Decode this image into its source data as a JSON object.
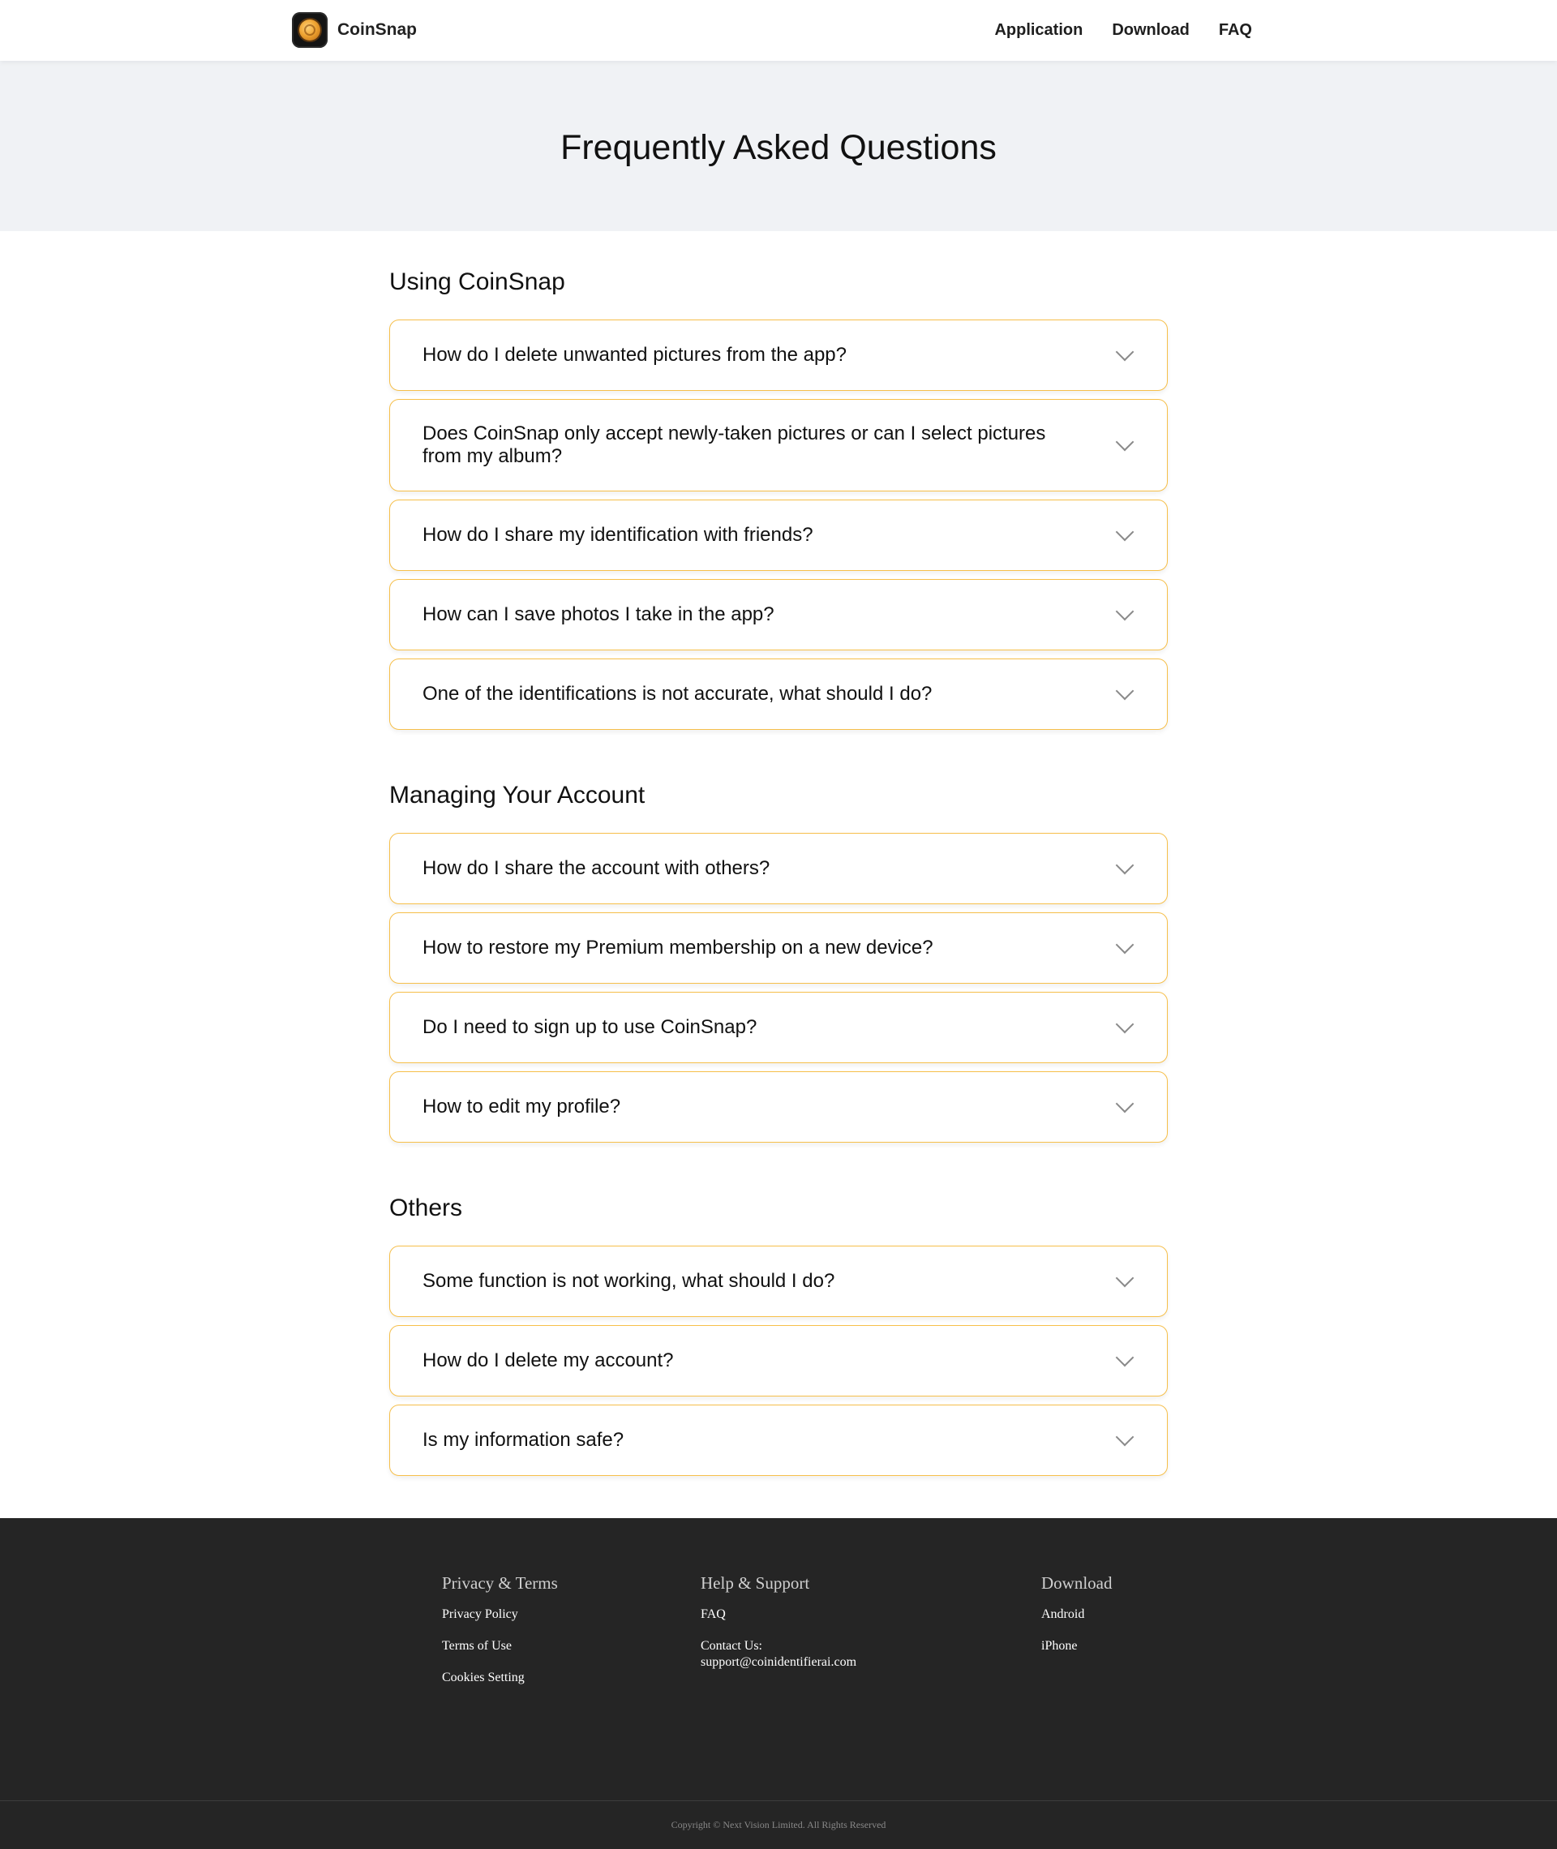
{
  "header": {
    "brand": "CoinSnap",
    "logo_icon": "coin-logo-icon",
    "nav": [
      "Application",
      "Download",
      "FAQ"
    ]
  },
  "hero": {
    "title": "Frequently Asked Questions"
  },
  "sections": [
    {
      "title": "Using CoinSnap",
      "questions": [
        "How do I delete unwanted pictures from the app?",
        "Does CoinSnap only accept newly-taken pictures or can I select pictures from my album?",
        "How do I share my identification with friends?",
        "How can I save photos I take in the app?",
        "One of the identifications is not accurate, what should I do?"
      ]
    },
    {
      "title": "Managing Your Account",
      "questions": [
        "How do I share the account with others?",
        "How to restore my Premium membership on a new device?",
        "Do I need to sign up to use CoinSnap?",
        "How to edit my profile?"
      ]
    },
    {
      "title": "Others",
      "questions": [
        "Some function is not working, what should I do?",
        "How do I delete my account?",
        "Is my information safe?"
      ]
    }
  ],
  "footer": {
    "columns": [
      {
        "title": "Privacy & Terms",
        "links": [
          "Privacy Policy",
          "Terms of Use",
          "Cookies Setting"
        ]
      },
      {
        "title": "Help & Support",
        "links": [
          "FAQ",
          "Contact Us:",
          "support@coinidentifierai.com"
        ]
      },
      {
        "title": "Download",
        "links": [
          "Android",
          "iPhone"
        ]
      }
    ],
    "copyright": "Copyright © Next Vision Limited. All Rights Reserved"
  },
  "colors": {
    "accent_border": "#f6bf4a",
    "hero_bg": "#f0f2f5",
    "footer_bg": "#252525"
  }
}
